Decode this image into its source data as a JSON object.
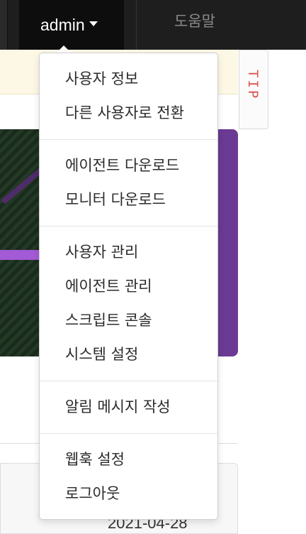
{
  "navbar": {
    "user_label": "admin",
    "help_label": "도움말"
  },
  "tip": {
    "label": "TIP"
  },
  "card": {
    "date": "2021-04-28"
  },
  "colors": {
    "navbar_bg": "#1e1e1e",
    "banner": "#6b3a93",
    "notice_bg": "#fdf8e6",
    "tip_text": "#d9534f"
  },
  "dropdown": {
    "groups": [
      {
        "items": [
          {
            "label": "사용자 정보"
          },
          {
            "label": "다른 사용자로 전환"
          }
        ]
      },
      {
        "items": [
          {
            "label": "에이전트 다운로드"
          },
          {
            "label": "모니터 다운로드"
          }
        ]
      },
      {
        "items": [
          {
            "label": "사용자 관리"
          },
          {
            "label": "에이전트 관리"
          },
          {
            "label": "스크립트 콘솔"
          },
          {
            "label": "시스템 설정"
          }
        ]
      },
      {
        "items": [
          {
            "label": "알림 메시지 작성"
          }
        ]
      },
      {
        "items": [
          {
            "label": "웹훅 설정"
          },
          {
            "label": "로그아웃"
          }
        ]
      }
    ]
  }
}
